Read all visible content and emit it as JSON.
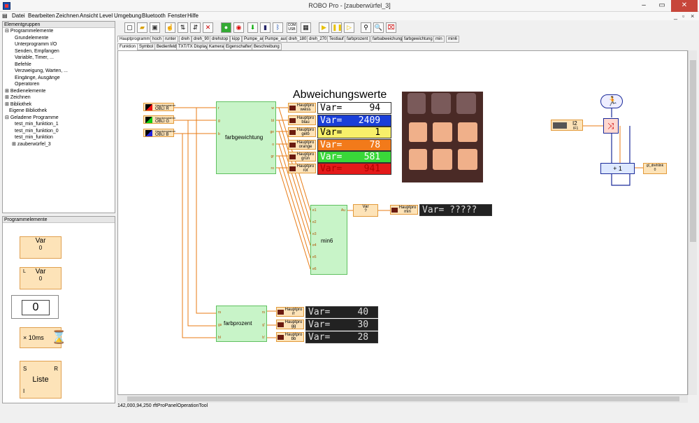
{
  "window": {
    "title": "ROBO Pro - [zauberwürfel_3]"
  },
  "menu": [
    "Datei",
    "Bearbeiten",
    "Zeichnen",
    "Ansicht",
    "Level",
    "Umgebung",
    "Bluetooth",
    "Fenster",
    "Hilfe"
  ],
  "groups_panel": {
    "title": "Elementgruppen",
    "items": [
      "Programmelemente",
      "Grundelemente",
      "Unterprogramm I/O",
      "Senden, Empfangen",
      "Variable, Timer, ...",
      "Befehle",
      "Verzweigung, Warten, ...",
      "Eingänge, Ausgänge",
      "Operatoren",
      "Bedienelemente",
      "Zeichnen",
      "Bibliothek",
      "Eigene Bibliothek",
      "Geladene Programme",
      "test_min_funktion_1",
      "test_min_funktion_0",
      "test_min_funktion",
      "zauberwürfel_3"
    ]
  },
  "elements_panel": {
    "title": "Programmelemente",
    "var_label": "Var",
    "var_value": "0",
    "list_var_label": "Var",
    "list_var_value": "0",
    "list_prefix": "L",
    "display_value": "0",
    "wait_label": "× 10ms",
    "list_label": "Liste",
    "list_s": "S",
    "list_r": "R",
    "list_i": "I"
  },
  "toolbar_icons": [
    "new-icon",
    "open-icon",
    "save-icon",
    "hand-icon",
    "split-icon",
    "toggle-icon",
    "delete-icon",
    "start-icon",
    "stop-icon",
    "download-icon",
    "terminal-icon",
    "bluetooth-icon",
    "com-usb-icon",
    "calendar-icon",
    "play-icon",
    "pause-icon",
    "step-icon",
    "zoom-icon",
    "zoom-out-icon",
    "cleanup-icon"
  ],
  "program_tabs": [
    "Hauptprogramm",
    "hoch",
    "runter",
    "dreh",
    "dreh_90",
    "drehstop",
    "kipp",
    "Pumpe_an",
    "Pumpe_aus",
    "dreh_180",
    "dreh_270",
    "Testlauf",
    "farbprozent",
    "farbabweichung",
    "farbgewichtung",
    "min",
    "min6"
  ],
  "view_tabs": [
    "Funktion",
    "Symbol",
    "Bedienfeld",
    "TXT/TX Display",
    "Kamera",
    "Eigenschaften",
    "Beschreibung"
  ],
  "status": "142,000,94,250 rftProPanelOperationTool",
  "diagram": {
    "heading": "Abweichungswerte",
    "sensors": [
      {
        "sub": "Hauptprogramm",
        "label": "OBLI R"
      },
      {
        "sub": "Hauptprogramm",
        "label": "OBLI G"
      },
      {
        "sub": "Hauptprogramm",
        "label": "OBLI B"
      }
    ],
    "farbgewichtung": {
      "name": "farbgewichtung",
      "inputs": [
        "r",
        "g",
        "b"
      ],
      "outputs": [
        "w",
        "bl",
        "ge",
        "o",
        "gr",
        "ro"
      ]
    },
    "color_displays": [
      {
        "top": "Hauptpro",
        "name": "weiss",
        "text": "Var=     94",
        "bg": "#ffffff",
        "fg": "#000000"
      },
      {
        "top": "Hauptpro",
        "name": "blau",
        "text": "Var=   2409",
        "bg": "#1a3fd8",
        "fg": "#ffffff"
      },
      {
        "top": "Hauptpro",
        "name": "gelb",
        "text": "Var=      1",
        "bg": "#f8f06a",
        "fg": "#000000"
      },
      {
        "top": "Hauptpro",
        "name": "orange",
        "text": "Var=     78",
        "bg": "#f27a1a",
        "fg": "#ffffff"
      },
      {
        "top": "Hauptpro",
        "name": "grün",
        "text": "Var=    581",
        "bg": "#39d839",
        "fg": "#ffffff"
      },
      {
        "top": "Hauptpro",
        "name": "rot",
        "text": "Var=    941",
        "bg": "#e41a1a",
        "fg": "#b00000"
      }
    ],
    "min6": {
      "name": "min6",
      "inputs": [
        "e1",
        "e2",
        "e3",
        "e4",
        "e5",
        "e6"
      ],
      "output": "Au"
    },
    "var_q": {
      "label": "Var",
      "value": "?"
    },
    "min_display": {
      "top": "Hauptpro",
      "name": "min",
      "text": "Var= ?????"
    },
    "farbprozent": {
      "name": "farbprozent",
      "inputs": [
        "rs",
        "gs",
        "bl"
      ],
      "outputs": [
        "rs",
        "g'",
        "b'"
      ]
    },
    "pct_displays": [
      {
        "top": "Hauptpro",
        "name": "rr",
        "text": "Var=     40"
      },
      {
        "top": "Hauptpro",
        "name": "gg",
        "text": "Var=     30"
      },
      {
        "top": "Hauptpro",
        "name": "bb",
        "text": "Var=     28"
      }
    ],
    "i2": {
      "label": "I2",
      "sub": "IF1"
    },
    "plus_one": "+ 1",
    "gl_drehlink": {
      "label": "gl_drehlink",
      "value": "0"
    }
  },
  "colors": {
    "accent_orange": "#e87b14",
    "wire": "#e87b14",
    "blue_wire": "#1a2a9a",
    "green_block": "#c8f4c8"
  }
}
